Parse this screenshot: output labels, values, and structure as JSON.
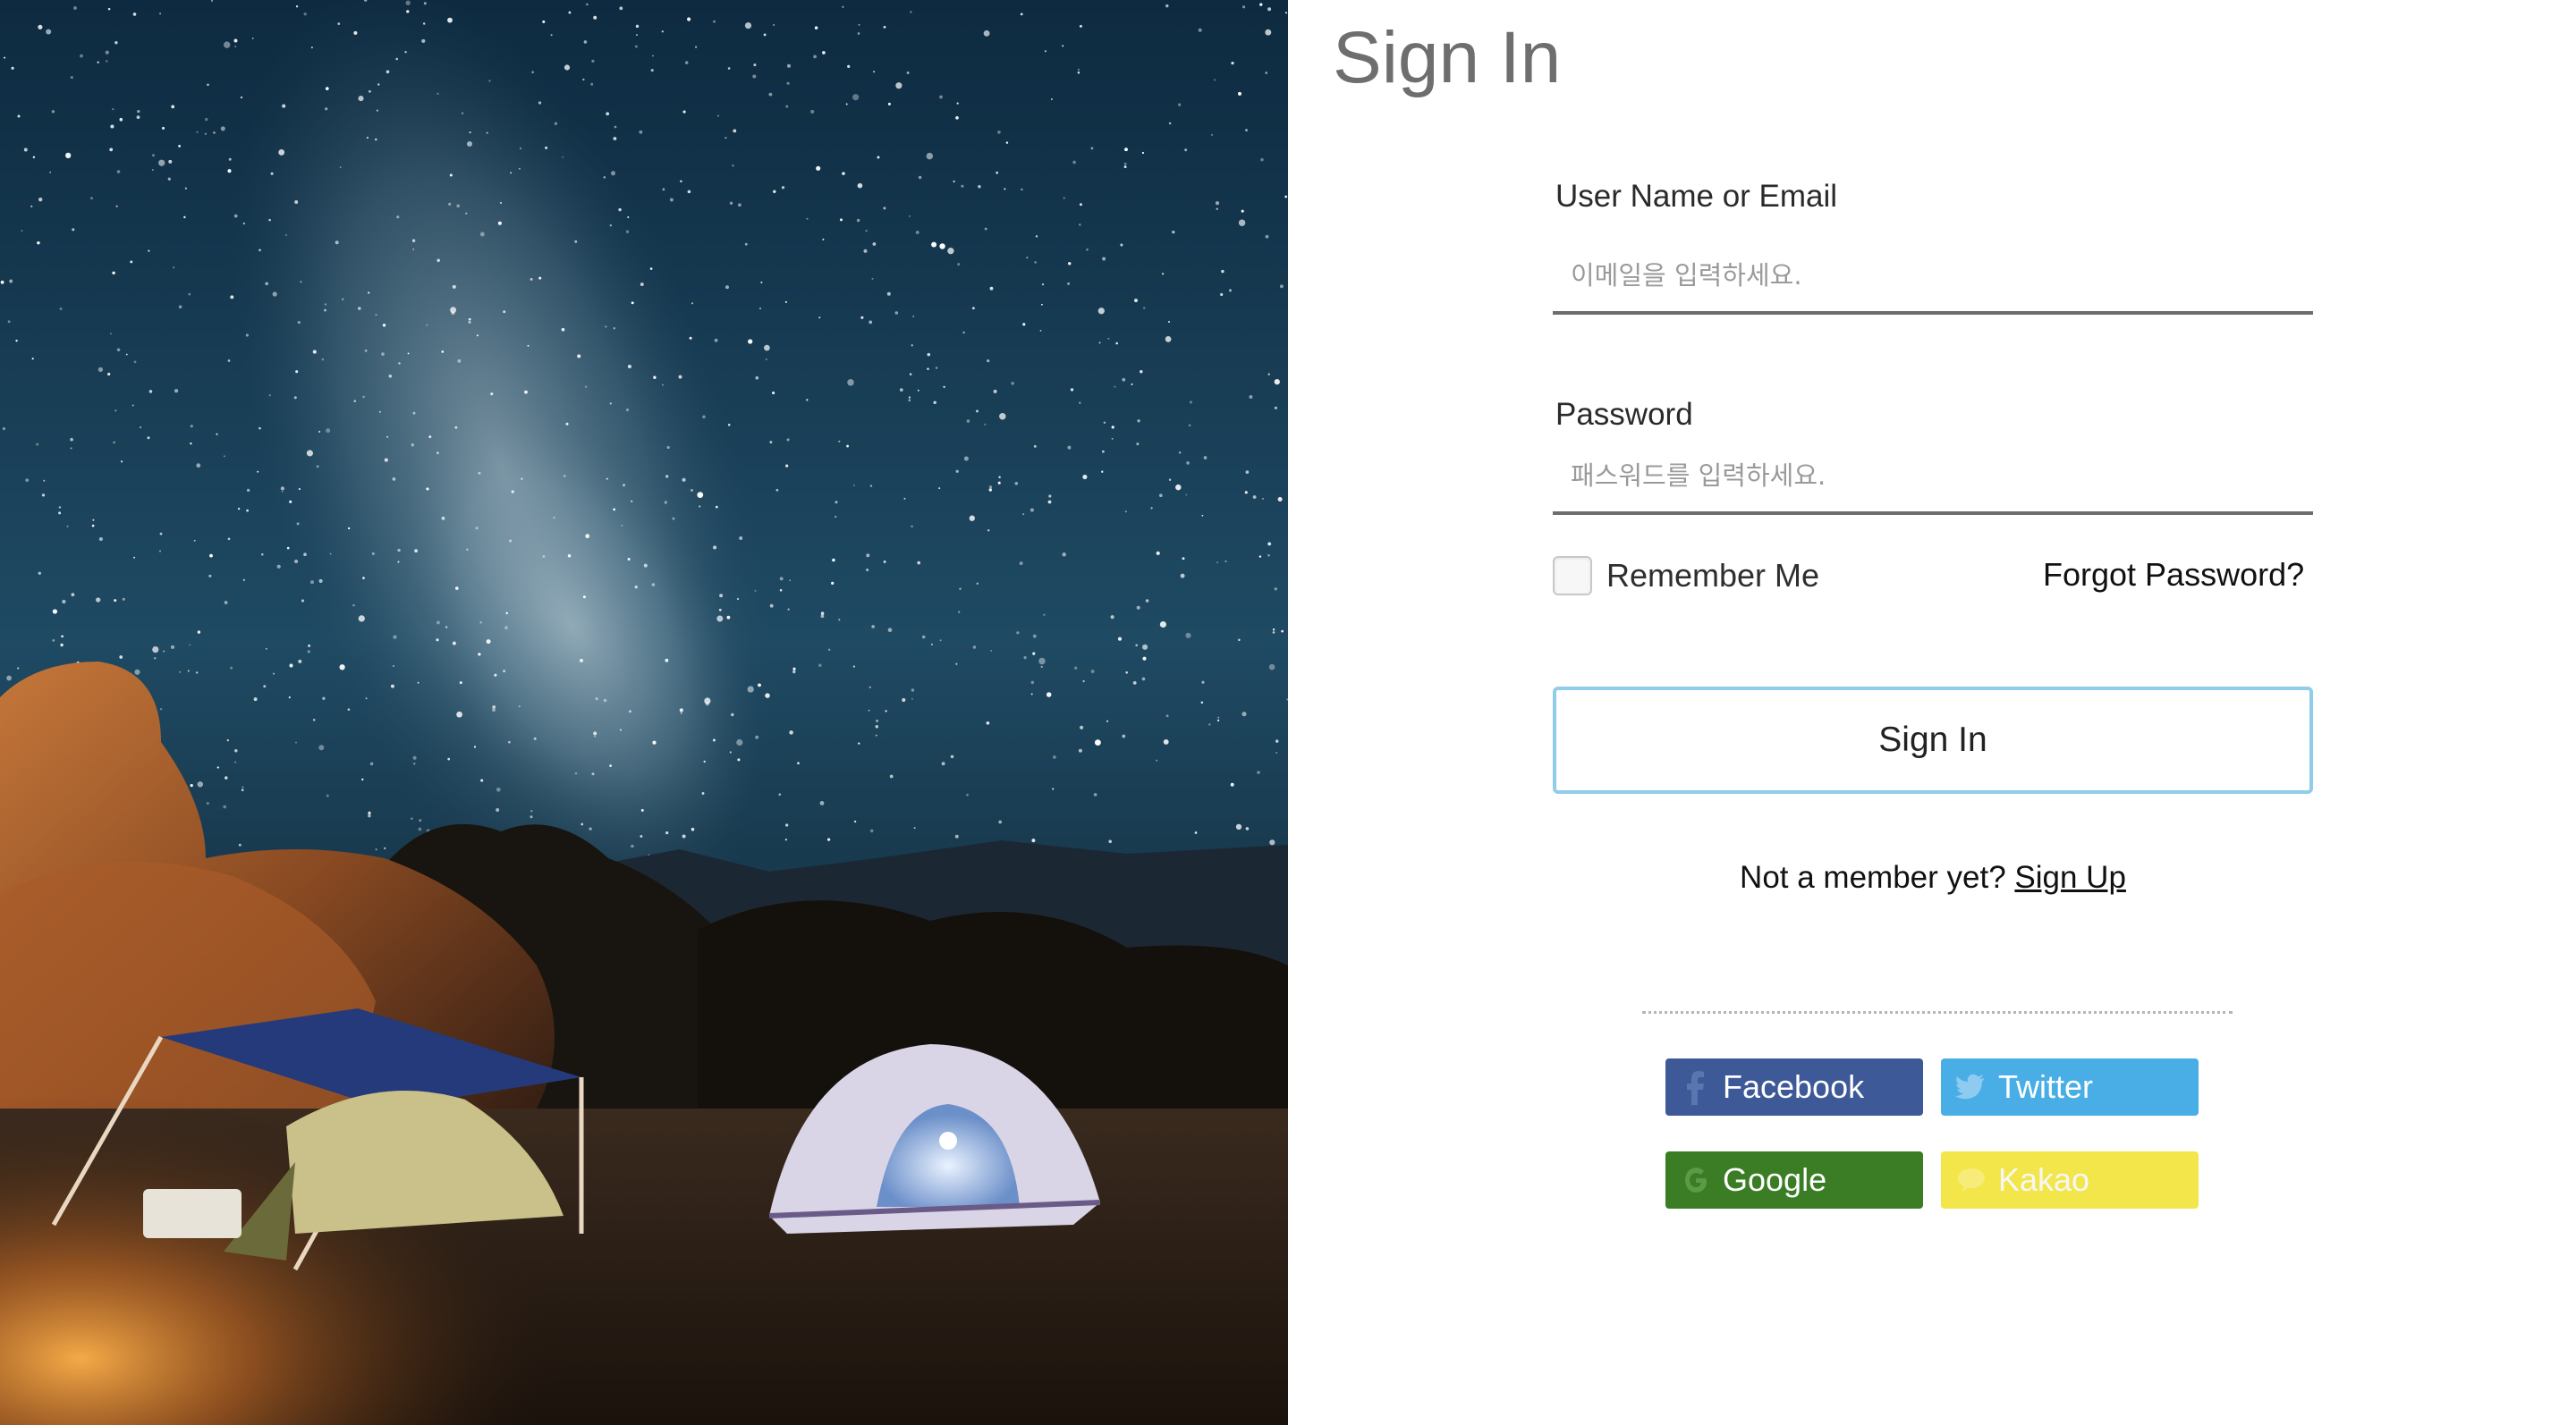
{
  "login": {
    "title": "Sign In",
    "username_label": "User Name or Email",
    "username_placeholder": "이메일을 입력하세요.",
    "password_label": "Password",
    "password_placeholder": "패스워드를 입력하세요.",
    "remember_label": "Remember Me",
    "forgot_label": "Forgot Password?",
    "submit_label": "Sign In",
    "signup_prompt": "Not a member yet?",
    "signup_link": "Sign Up"
  },
  "social": {
    "facebook": "Facebook",
    "twitter": "Twitter",
    "google": "Google",
    "kakao": "Kakao"
  },
  "colors": {
    "facebook": "#3e5998",
    "twitter": "#4aaee6",
    "google": "#3a7d25",
    "kakao": "#f3e64a",
    "submit_border": "#8fcdea"
  },
  "icons": [
    "facebook-icon",
    "twitter-icon",
    "google-icon",
    "kakao-icon"
  ]
}
